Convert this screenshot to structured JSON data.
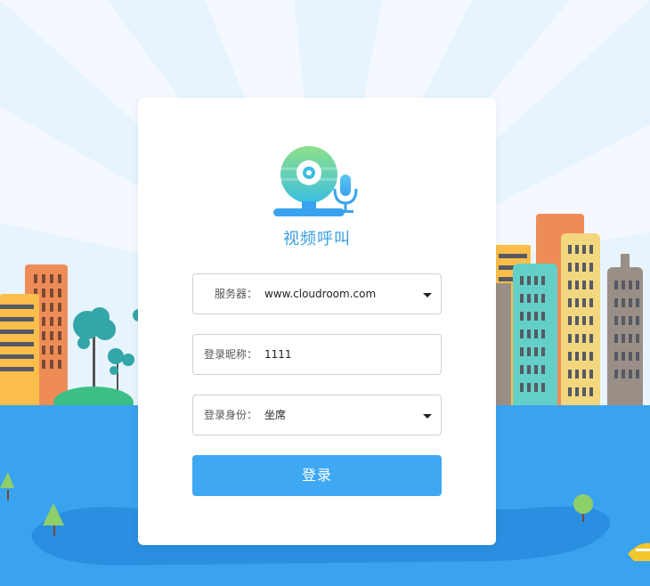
{
  "app": {
    "title": "视频呼叫"
  },
  "form": {
    "server": {
      "label": "服务器：",
      "value": "www.cloudroom.com"
    },
    "nickname": {
      "label": "登录昵称：",
      "value": "1111"
    },
    "role": {
      "label": "登录身份：",
      "value": "坐席"
    }
  },
  "login_button": {
    "label": "登录"
  },
  "icons": [
    "webcam-microphone-logo-icon",
    "chevron-down-icon"
  ],
  "colors": {
    "accent": "#3ea8f3",
    "title": "#3a9ee4",
    "water": "#3aa3ef",
    "sky": "#e8f4fd"
  }
}
